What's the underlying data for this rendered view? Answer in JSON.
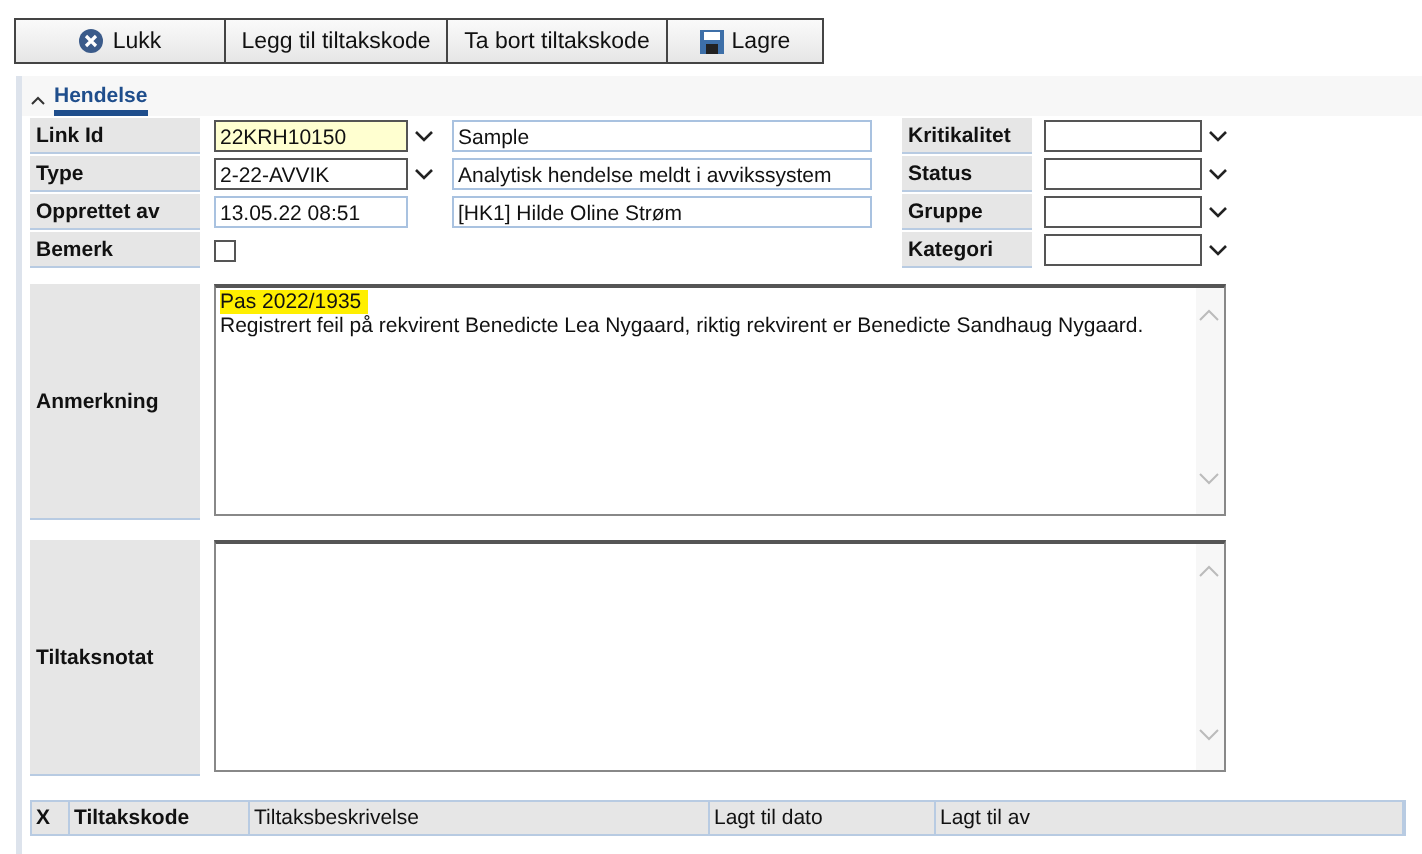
{
  "toolbar": [
    {
      "label": "Lukk"
    },
    {
      "label": "Legg til tiltakskode"
    },
    {
      "label": "Ta bort tiltakskode"
    },
    {
      "label": "Lagre"
    }
  ],
  "section": {
    "title": "Hendelse",
    "expanded": true
  },
  "fields_left": [
    {
      "label": "Link Id",
      "kind": "select",
      "value": "22KRH10150",
      "highlighted": true,
      "extra": "Sample"
    },
    {
      "label": "Type",
      "kind": "select",
      "value": "2-22-AVVIK",
      "highlighted": false,
      "extra": "Analytisk hendelse meldt i avvikssystem"
    },
    {
      "label": "Opprettet av",
      "kind": "text",
      "value": "13.05.22 08:51",
      "highlighted": false,
      "extra": "[HK1] Hilde Oline Strøm"
    },
    {
      "label": "Bemerk",
      "kind": "checkbox",
      "checked": false
    }
  ],
  "fields_right": [
    {
      "label": "Kritikalitet"
    },
    {
      "label": "Status"
    },
    {
      "label": "Gruppe"
    },
    {
      "label": "Kategori"
    }
  ],
  "notes": [
    {
      "label": "Anmerkning",
      "lines": [
        {
          "text": "Pas 2022/1935",
          "highlighted": true
        },
        {
          "text": "Registrert feil på rekvirent Benedicte Lea Nygaard, riktig rekvirent er Benedicte Sandhaug Nygaard.",
          "highlighted": false
        }
      ]
    },
    {
      "label": "Tiltaksnotat"
    }
  ],
  "table": {
    "columns": [
      {
        "label": "X",
        "bold": true
      },
      {
        "label": "Tiltakskode",
        "bold": true
      },
      {
        "label": "Tiltaksbeskrivelse",
        "bold": false
      },
      {
        "label": "Lagt til dato",
        "bold": false
      },
      {
        "label": "Lagt til av",
        "bold": false
      }
    ]
  }
}
